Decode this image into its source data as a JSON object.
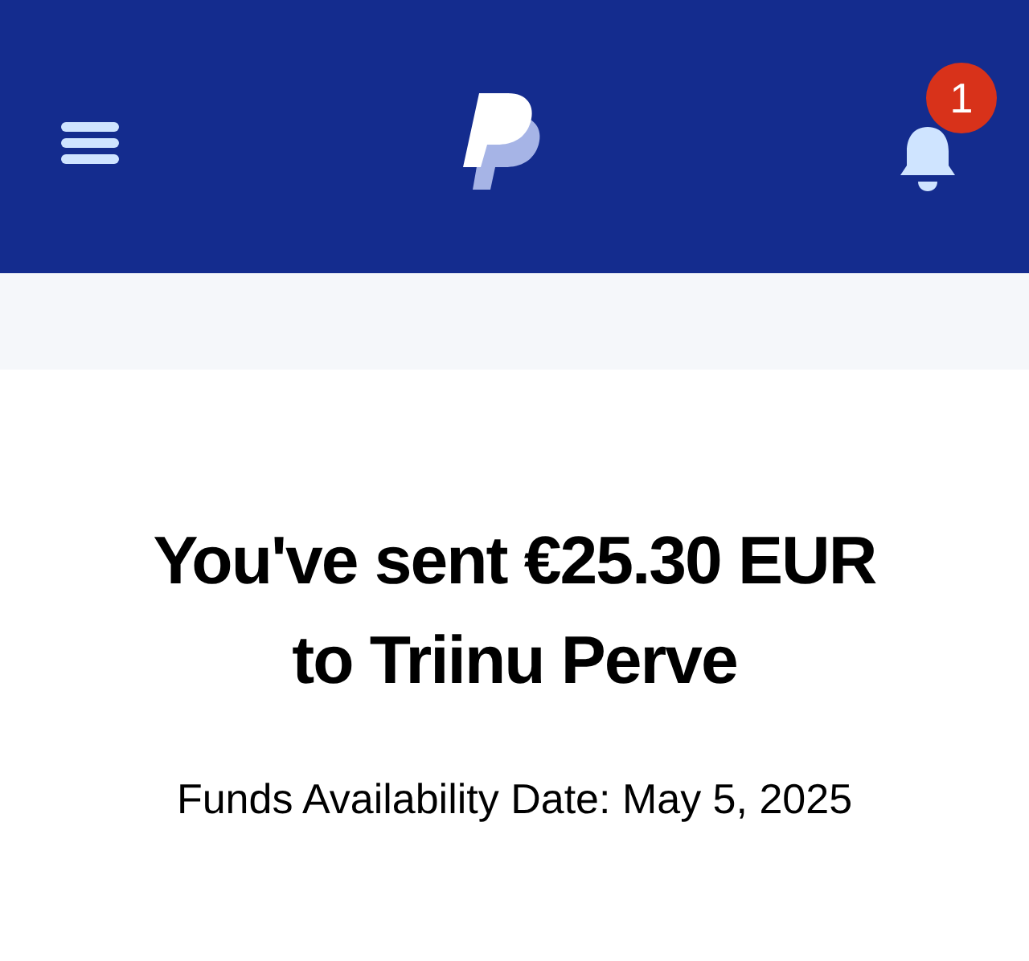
{
  "header": {
    "notifications": {
      "count": "1"
    }
  },
  "confirmation": {
    "title_line_1": "You've sent €25.30 EUR",
    "title_line_2": "to Triinu Perve",
    "subtitle": "Funds Availability Date: May 5, 2025"
  }
}
